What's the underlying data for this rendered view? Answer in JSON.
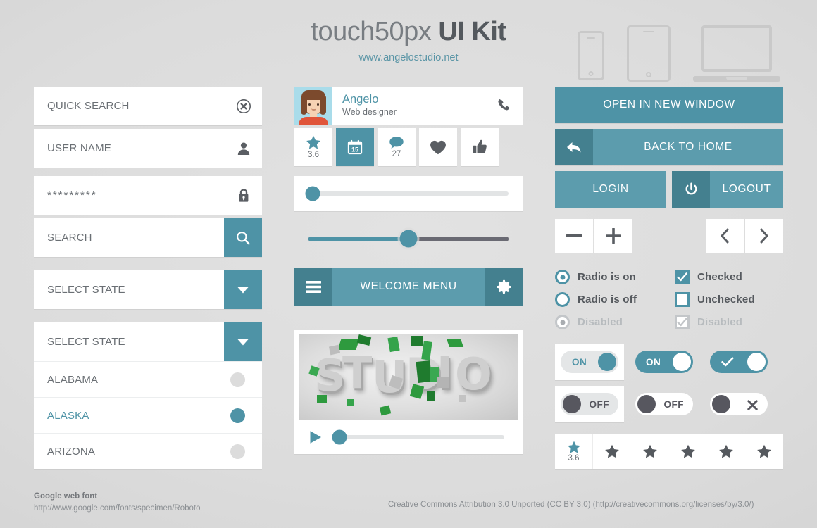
{
  "header": {
    "title_light": "touch50px",
    "title_bold": "UI Kit",
    "subtitle": "www.angelostudio.net",
    "devices": [
      "phone-icon",
      "tablet-icon",
      "laptop-icon"
    ]
  },
  "left_column": {
    "quick_search": {
      "label": "QUICK SEARCH",
      "icon": "clear-circle-icon"
    },
    "user_name": {
      "label": "USER NAME",
      "icon": "user-icon"
    },
    "password": {
      "value": "*********",
      "icon": "lock-icon"
    },
    "search": {
      "label": "SEARCH",
      "icon": "search-icon"
    },
    "select_single": {
      "label": "SELECT STATE",
      "icon": "chevron-down-icon"
    },
    "select_open": {
      "label": "SELECT STATE",
      "icon": "chevron-down-icon",
      "options": [
        {
          "label": "ALABAMA",
          "selected": false
        },
        {
          "label": "ALASKA",
          "selected": true
        },
        {
          "label": "ARIZONA",
          "selected": false
        }
      ]
    }
  },
  "middle_column": {
    "profile": {
      "name": "Angelo",
      "role": "Web designer",
      "avatar": "avatar-image",
      "call_icon": "phone-icon"
    },
    "actions": [
      {
        "icon": "star-icon",
        "value": "3.6",
        "active": false
      },
      {
        "icon": "calendar-icon",
        "value": "15",
        "active": true
      },
      {
        "icon": "comment-icon",
        "value": "27",
        "active": false
      },
      {
        "icon": "heart-icon",
        "value": "",
        "active": false
      },
      {
        "icon": "thumbs-up-icon",
        "value": "",
        "active": false
      }
    ],
    "slider_card": {
      "value": 2
    },
    "slider_bare": {
      "value": 50
    },
    "menu": {
      "label": "WELCOME MENU",
      "left_icon": "hamburger-icon",
      "right_icon": "gear-icon"
    },
    "video": {
      "thumb_text": "STUDIO",
      "play_icon": "play-icon",
      "progress": 4
    }
  },
  "right_column": {
    "open_new_window": "OPEN IN NEW WINDOW",
    "back_to_home": {
      "label": "BACK TO HOME",
      "icon": "back-arrow-icon"
    },
    "login": "LOGIN",
    "logout": {
      "label": "LOGOUT",
      "icon": "power-icon"
    },
    "steppers": [
      {
        "name": "minus-button",
        "glyph": "−"
      },
      {
        "name": "plus-button",
        "glyph": "+"
      },
      {
        "name": "prev-button",
        "glyph": "‹"
      },
      {
        "name": "next-button",
        "glyph": "›"
      }
    ],
    "choices": [
      {
        "label": "Radio is on",
        "type": "radio",
        "state": "on"
      },
      {
        "label": "Checked",
        "type": "checkbox",
        "state": "on"
      },
      {
        "label": "Radio is off",
        "type": "radio",
        "state": "off"
      },
      {
        "label": "Unchecked",
        "type": "checkbox",
        "state": "off"
      },
      {
        "label": "Disabled",
        "type": "radio",
        "state": "disabled"
      },
      {
        "label": "Disabled",
        "type": "checkbox",
        "state": "disabled"
      }
    ],
    "toggles": [
      {
        "label": "ON",
        "state": "on",
        "style": "light-boxed"
      },
      {
        "label": "ON",
        "state": "on",
        "style": "teal"
      },
      {
        "label": "check-icon",
        "state": "on",
        "style": "teal-icon"
      },
      {
        "label": "OFF",
        "state": "off",
        "style": "light-boxed"
      },
      {
        "label": "OFF",
        "state": "off",
        "style": "white"
      },
      {
        "label": "close-icon",
        "state": "off",
        "style": "white-icon"
      }
    ],
    "rating": {
      "value": "3.6",
      "filled": 1,
      "total": 6
    }
  },
  "footer": {
    "left_title": "Google web font",
    "left_url": "http://www.google.com/fonts/specimen/Roboto",
    "right": "Creative Commons Attribution 3.0 Unported (CC BY 3.0)  (http://creativecommons.org/licenses/by/3.0/)"
  },
  "colors": {
    "teal": "#4e93a6",
    "teal_light": "#5c9cad",
    "teal_dark": "#44808f",
    "bg": "#dcdcdc",
    "text": "#5a5e63"
  }
}
